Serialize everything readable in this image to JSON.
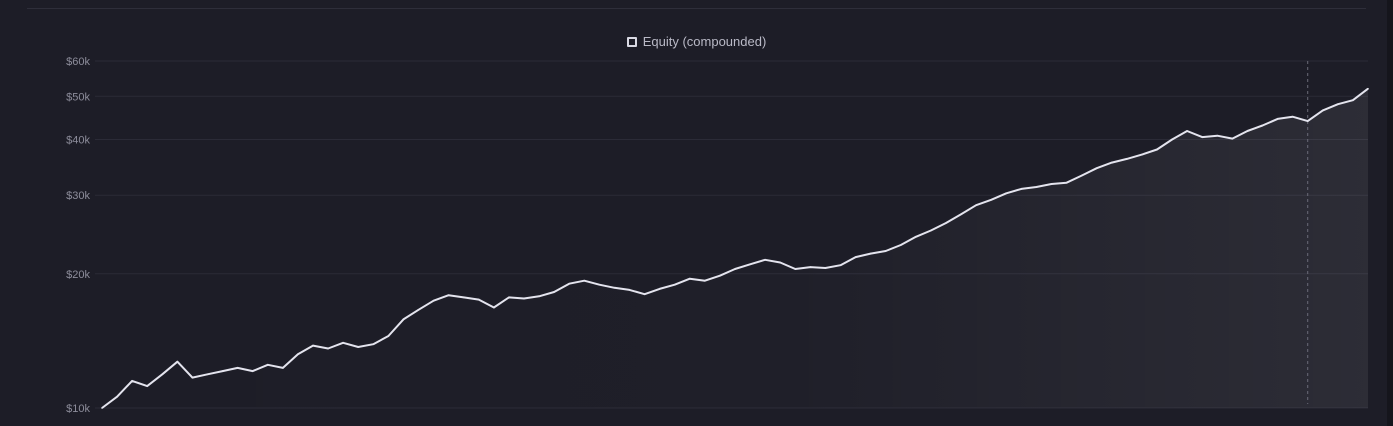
{
  "chart_data": {
    "type": "line",
    "title": "",
    "legend": {
      "position": "top-center",
      "entries": [
        "Equity (compounded)"
      ]
    },
    "y_scale": "log",
    "ylim": [
      10000,
      60000
    ],
    "y_ticks": [
      {
        "value": 10000,
        "label": "$10k"
      },
      {
        "value": 20000,
        "label": "$20k"
      },
      {
        "value": 30000,
        "label": "$30k"
      },
      {
        "value": 40000,
        "label": "$40k"
      },
      {
        "value": 50000,
        "label": "$50k"
      },
      {
        "value": 60000,
        "label": "$60k"
      }
    ],
    "grid": true,
    "series": [
      {
        "name": "Equity (compounded)",
        "color": "#e4e4ee",
        "fill": "area-under-line",
        "values": [
          10000,
          10600,
          11500,
          11200,
          11900,
          12700,
          11700,
          11900,
          12100,
          12300,
          12100,
          12500,
          12300,
          13200,
          13800,
          13600,
          14000,
          13700,
          13900,
          14500,
          15800,
          16600,
          17400,
          17900,
          17700,
          17500,
          16800,
          17700,
          17600,
          17800,
          18200,
          19000,
          19300,
          18900,
          18600,
          18400,
          18000,
          18500,
          18900,
          19500,
          19300,
          19800,
          20500,
          21000,
          21500,
          21200,
          20500,
          20700,
          20600,
          20900,
          21800,
          22200,
          22500,
          23200,
          24200,
          25000,
          26000,
          27200,
          28500,
          29300,
          30300,
          31000,
          31300,
          31800,
          32000,
          33200,
          34500,
          35500,
          36200,
          37000,
          38000,
          40000,
          41800,
          40500,
          40800,
          40200,
          41800,
          43000,
          44500,
          45000,
          44000,
          46500,
          48000,
          49000,
          52000
        ]
      }
    ],
    "annotations": [
      {
        "type": "vertical-dashed-line",
        "x_index": 80
      }
    ]
  }
}
